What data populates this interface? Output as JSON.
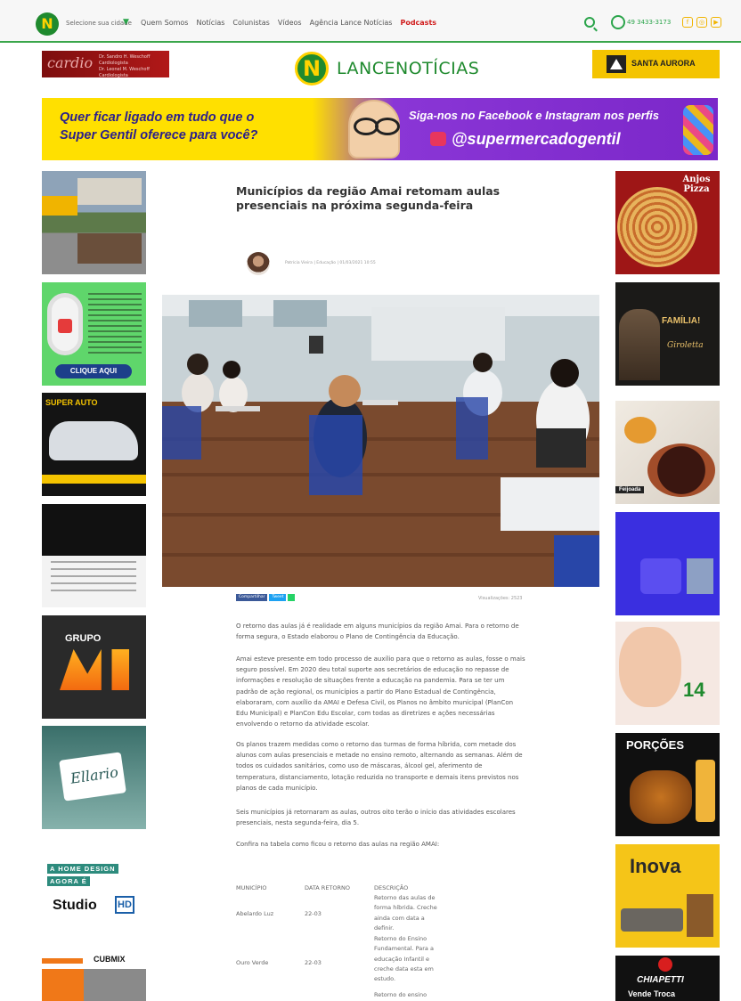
{
  "topnav": {
    "logo_letter": "N",
    "city_label": "Selecione sua cidade",
    "links": [
      "Quem Somos",
      "Notícias",
      "Colunistas",
      "Vídeos",
      "Agência Lance Notícias",
      "Podcasts"
    ],
    "phone": "49 3433-3173"
  },
  "header": {
    "brand_left": "LANCE",
    "brand_right": "NOTÍCIAS",
    "brand_letter": "N",
    "ad_left_text": "cardio",
    "ad_left_sub": "Dr. Sandro H. Weschoff Cardiologista\nDr. Leonel M. Weschoff Cardiologista",
    "ad_right_text": "SANTA AURORA"
  },
  "banner": {
    "left_line1": "Quer ficar ligado em tudo que o",
    "left_line2": "Super Gentil oferece para você?",
    "right_line1": "Siga-nos no Facebook e Instagram nos perfis",
    "right_handle": "@supermercadogentil"
  },
  "left_ads": [
    {
      "name": "home-design-ad",
      "text": ""
    },
    {
      "name": "security-ad",
      "text": "CLIQUE AQUI"
    },
    {
      "name": "super-auto-ad",
      "text": "SUPER AUTO"
    },
    {
      "name": "black-ad",
      "text": ""
    },
    {
      "name": "grupo-m1-ad",
      "text": "GRUPO"
    },
    {
      "name": "ellario-ad",
      "text": "Ellario"
    },
    {
      "name": "studio-hd-ad",
      "line1": "A HOME DESIGN",
      "line2": "AGORA É",
      "line3": "Studio"
    },
    {
      "name": "cubmix-ad",
      "text": "CUBMIX"
    }
  ],
  "right_ads": [
    {
      "name": "anjos-pizza-ad",
      "text": "Anjos Pizza"
    },
    {
      "name": "giroletta-ad",
      "text": "FAMÍLIA!",
      "sub": "Giroletta"
    },
    {
      "name": "feijoada-ad",
      "text": "Feijoada"
    },
    {
      "name": "blue-ad",
      "text": ""
    },
    {
      "name": "baby-ad",
      "text": "14"
    },
    {
      "name": "porcoes-ad",
      "text": "PORÇÕES"
    },
    {
      "name": "inova-ad",
      "text": "Inova"
    },
    {
      "name": "chiapetti-ad",
      "text": "CHIAPETTI",
      "sub": "Vende  Troca"
    }
  ],
  "article": {
    "title": "Municípios da região Amai retomam aulas presenciais na próxima segunda-feira",
    "byline": "Patrícia Vieira | Educação | 01/03/2021 10:55",
    "share_labels": [
      "Compartilhar",
      "Tweet"
    ],
    "views": "Visualizações: 2523",
    "paragraphs": [
      "O retorno das aulas já é realidade em alguns municípios da região Amai. Para o retorno de forma segura, o Estado elaborou o Plano de Contingência da Educação.",
      "Amai esteve presente em todo processo de auxílio para que o retorno as aulas, fosse o mais seguro possível. Em 2020 deu total suporte aos secretários de educação no repasse de informações e resolução de situações frente a educação na pandemia. Para se ter um padrão de ação regional, os municípios a partir do Plano Estadual de Contingência, elaboraram, com auxílio da AMAI e Defesa Civil, os Planos no âmbito municipal (PlanCon Edu Municipal) e PlanCon Edu Escolar, com todas as diretrizes e ações necessárias envolvendo o retorno da atividade escolar.",
      "Os planos trazem medidas como o retorno das turmas de forma híbrida, com metade dos alunos com aulas presenciais e metade no ensino remoto, alternando as semanas. Além de todos os cuidados sanitários, como uso de máscaras, álcool gel, aferimento de temperatura, distanciamento, lotação reduzida no transporte e demais itens previstos nos planos de cada município.",
      "Seis municípios já retornaram as aulas, outros oito terão o início das atividades escolares presenciais, nesta segunda-feira, dia 5.",
      "Confira na tabela como ficou o retorno das aulas na região AMAI:"
    ],
    "table": {
      "headers": [
        "MUNICÍPIO",
        "DATA RETORNO",
        "DESCRIÇÃO"
      ],
      "rows": [
        {
          "municipio": "Abelardo Luz",
          "data": "22-03",
          "descricao": "Retorno das aulas de forma híbrida. Creche ainda com data a definir."
        },
        {
          "municipio": "Ouro Verde",
          "data": "22-03",
          "descricao": "Retorno do Ensino Fundamental. Para a educação Infantil e creche data esta em estudo."
        },
        {
          "municipio": "",
          "data": "",
          "descricao": "Retorno do ensino"
        }
      ]
    }
  },
  "colors": {
    "brand_green": "#1f8a2e",
    "accent_yellow": "#ffd200",
    "podcasts_red": "#d01c1c"
  }
}
